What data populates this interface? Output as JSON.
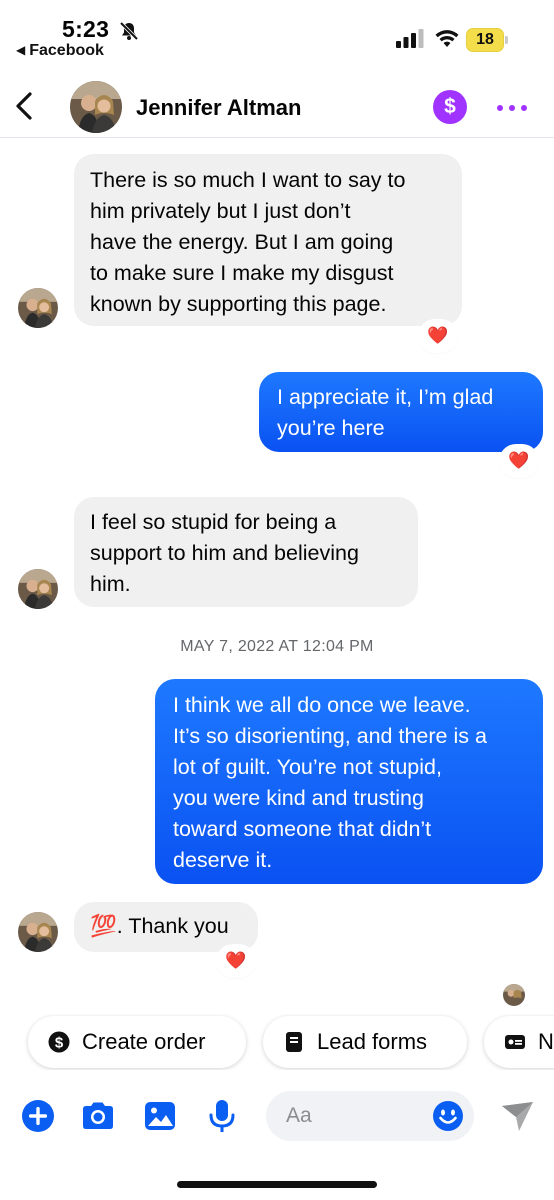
{
  "status_bar": {
    "time": "5:23",
    "back_app": "Facebook",
    "battery": "18",
    "icons": [
      "bell-slash-icon",
      "signal-icon",
      "wifi-icon",
      "battery-icon"
    ]
  },
  "header": {
    "contact_name": "Jennifer Altman",
    "icons": [
      "back-chevron-icon",
      "avatar",
      "dollar-icon",
      "more-icon"
    ],
    "accent_color": "#a033ff"
  },
  "messages": [
    {
      "direction": "incoming",
      "lines": [
        "There is so much I want to say to",
        "him privately but I just don’t",
        "have the energy. But I am going",
        "to make sure I make my disgust",
        "known by supporting this page."
      ],
      "reaction": "❤️"
    },
    {
      "direction": "outgoing",
      "lines": [
        "I appreciate it, I’m glad",
        "you’re here"
      ],
      "reaction": "❤️"
    },
    {
      "direction": "incoming",
      "lines": [
        "I feel so stupid for being a",
        "support to him and believing",
        "him."
      ]
    },
    {
      "direction": "outgoing",
      "lines": [
        "I think we all do once we leave.",
        "It’s so disorienting, and there is a",
        "lot of guilt. You’re not stupid,",
        "you were kind and trusting",
        "toward someone that didn’t",
        "deserve it."
      ]
    },
    {
      "direction": "incoming",
      "lines": [
        "💯. Thank you"
      ],
      "reaction": "❤️"
    }
  ],
  "timestamp": "MAY 7, 2022 AT 12:04 PM",
  "chips": [
    {
      "label": "Create order",
      "icon": "dollar-circle-icon"
    },
    {
      "label": "Lead forms",
      "icon": "document-icon"
    },
    {
      "label": "N",
      "icon": "card-icon"
    }
  ],
  "composer": {
    "placeholder": "Aa",
    "icons": [
      "plus-icon",
      "camera-icon",
      "image-icon",
      "microphone-icon",
      "emoji-icon",
      "send-icon"
    ]
  },
  "colors": {
    "outgoing_bubble": "#0a52f2",
    "incoming_bubble": "#f0f0f0",
    "messenger_blue": "#0a5ef2"
  }
}
